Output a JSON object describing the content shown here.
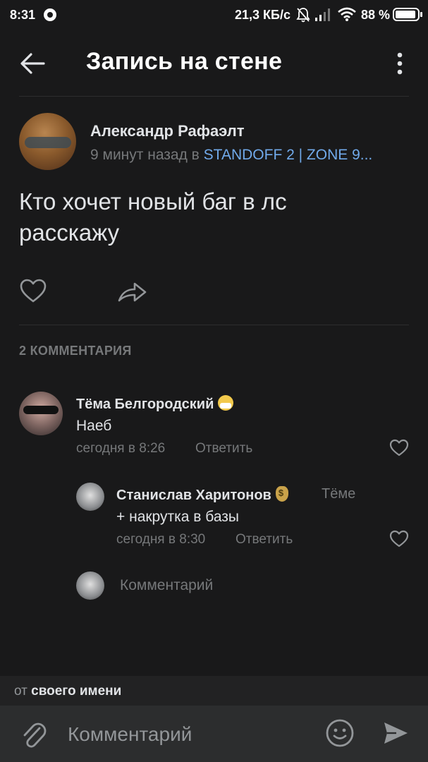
{
  "status_bar": {
    "time": "8:31",
    "speed": "21,3 КБ/с",
    "battery": "88 %"
  },
  "header": {
    "title": "Запись на стене"
  },
  "post": {
    "author": "Александр Рафаэлт",
    "time": "9 минут назад в ",
    "group": "STANDOFF 2 | ZONE 9...",
    "text_line1": "Кто хочет новый баг в лс",
    "text_line2": "расскажу"
  },
  "comments_header": "2 КОММЕНТАРИЯ",
  "comments": [
    {
      "author": "Тёма Белгородский",
      "text": "Наеб",
      "date": "сегодня в 8:26",
      "reply_label": "Ответить"
    },
    {
      "author": "Станислав Харитонов",
      "reply_to": "Тёме",
      "text": "+ накрутка в базы",
      "date": "сегодня в 8:30",
      "reply_label": "Ответить"
    }
  ],
  "inline_comment_placeholder": "Комментарий",
  "from_bar": {
    "prefix": "от ",
    "value": "своего имени"
  },
  "composer": {
    "placeholder": "Комментарий"
  },
  "colors": {
    "background": "#19191a",
    "accent_link": "#71aaeb",
    "secondary_text": "#76787a"
  }
}
